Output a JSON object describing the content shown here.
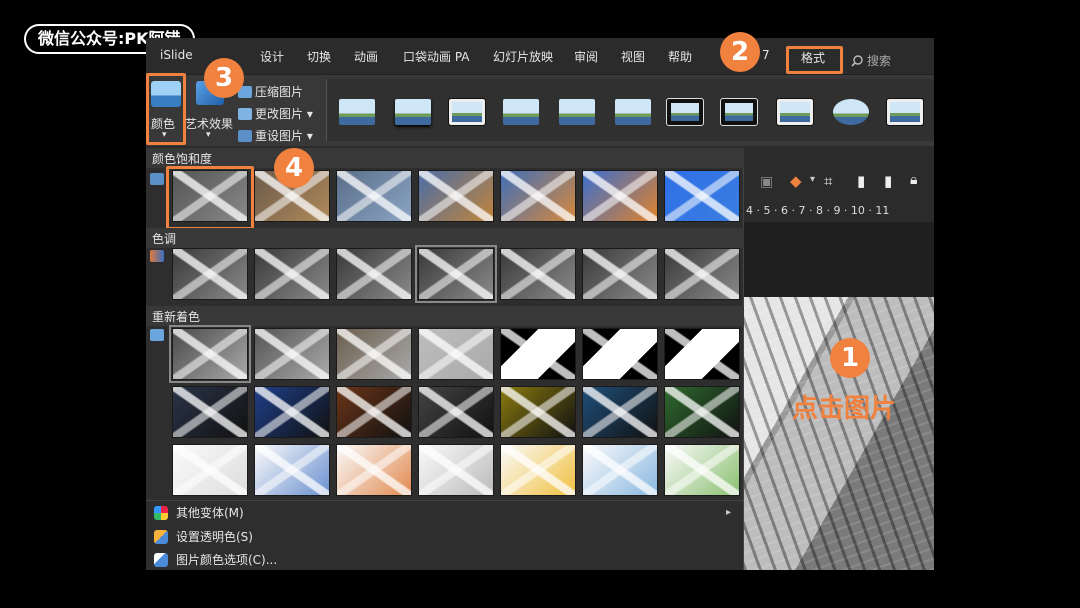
{
  "watermark": "微信公众号:PK阿错",
  "tabs": [
    "iSlide",
    "设计",
    "切换",
    "动画",
    "口袋动画 PA",
    "幻灯片放映",
    "审阅",
    "视图",
    "帮助",
    "格式"
  ],
  "tab_partial": "7",
  "active_tab": "格式",
  "search_placeholder": "搜索",
  "ribbon": {
    "color_btn": "颜色",
    "art_effects": "艺术效果",
    "compress": "压缩图片",
    "change": "更改图片",
    "reset": "重设图片"
  },
  "dropdown": {
    "sections": [
      "颜色饱和度",
      "色调",
      "重新着色"
    ],
    "menu_items": [
      {
        "label": "其他变体(M)",
        "icon": "color-wheel-icon",
        "has_arrow": true
      },
      {
        "label": "设置透明色(S)",
        "icon": "pen-icon",
        "has_arrow": false
      },
      {
        "label": "图片颜色选项(C)...",
        "icon": "picture-color-icon",
        "has_arrow": false
      }
    ]
  },
  "ruler_text": "4 · 5 · 6 · 7 · 8 · 9 · 10 · 11",
  "annotations": {
    "badge1": "1",
    "badge2": "2",
    "badge3": "3",
    "badge4": "4",
    "click_image": "点击图片"
  },
  "colors": {
    "accent": "#f0813f",
    "bg": "#2b2b2b"
  }
}
